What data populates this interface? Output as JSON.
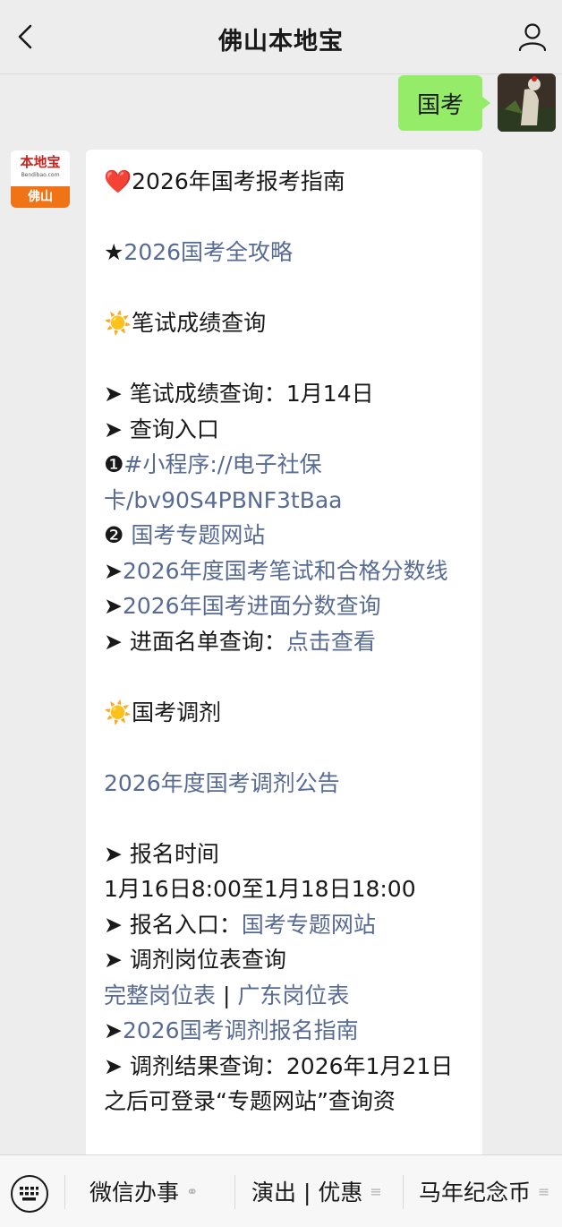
{
  "header": {
    "title": "佛山本地宝"
  },
  "user_message": {
    "text": "国考"
  },
  "bot_avatar": {
    "logo_text": "本地宝",
    "logo_sub": "Bendibao.com",
    "city": "佛山"
  },
  "bot_message": {
    "l1_icon": "❤️",
    "l1_text": "2026年国考报考指南",
    "l2_star": "★",
    "l2_link": "2026国考全攻略",
    "l3_icon": "☀️",
    "l3_text": "笔试成绩查询",
    "l4": "➤ 笔试成绩查询：1月14日",
    "l5": "➤ 查询入口",
    "l6_num": "❶",
    "l6_link": "#小程序://电子社保卡/bv90S4PBNF3tBaa",
    "l7_num": "❷",
    "l7_link": "国考专题网站",
    "l8_arrow": "➤",
    "l8_link": "2026年度国考笔试和合格分数线",
    "l9_arrow": "➤",
    "l9_link": "2026年国考进面分数查询",
    "l10_text": "➤ 进面名单查询：",
    "l10_link": "点击查看",
    "l11_icon": "☀️",
    "l11_text": "国考调剂",
    "l12_link": "2026年度国考调剂公告",
    "l13": "➤ 报名时间",
    "l14": "1月16日8:00至1月18日18:00",
    "l15_text": "➤ 报名入口：",
    "l15_link": "国考专题网站",
    "l16": "➤ 调剂岗位表查询",
    "l17_link_a": "完整岗位表",
    "l17_sep": " | ",
    "l17_link_b": "广东岗位表",
    "l18_arrow": "➤",
    "l18_link": "2026国考调剂报名指南",
    "l19": "➤ 调剂结果查询：2026年1月21日之后可登录“专题网站”查询资"
  },
  "bottom_menu": {
    "items": [
      {
        "label": "微信办事",
        "icon": "link-icon"
      },
      {
        "label": "演出 | 优惠",
        "icon": "menu-icon"
      },
      {
        "label": "马年纪念币",
        "icon": "menu-icon"
      }
    ]
  },
  "colors": {
    "link": "#576b95",
    "user_bubble": "#95ec69",
    "background": "#ededed"
  }
}
